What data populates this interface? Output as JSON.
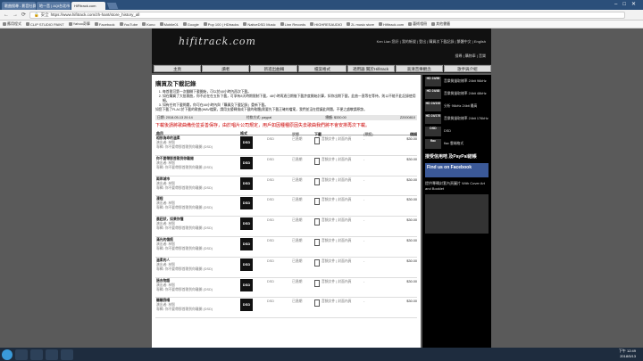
{
  "browser": {
    "tabs": [
      {
        "label": "歌曲搜尋 - 影音社群"
      },
      {
        "label": "地一音 | AQI台北市"
      },
      {
        "label": "HiFitrack.com"
      }
    ],
    "url": "https://www.hifitrack.com/zh-hant/store_history_all",
    "secure_label": "安全"
  },
  "bookmarks": [
    "應用程式",
    "CLIP STUDIO PAINT",
    "Yahoo奇摩",
    "Facebook",
    "YouTube",
    "Kono",
    "Mobile01",
    "Google",
    "Pop 100 | HDtracks",
    "NativeDSD Music",
    "Linn Records",
    "HIGHRESAUDIO",
    "2L music store",
    "Hifitrack.com",
    "藝術相冊",
    "其他書籤"
  ],
  "site": {
    "logo": "hifitrack.com",
    "user_line": "Ken Lian 您好 | 我的帳號 | 登出 | 購買次下載記錄 | 繁體中文 | English",
    "user_line2": "搜尋 | 購物車 | 音樂",
    "menu": [
      "主頁",
      "讀者",
      "新進出曲輯",
      "檔案格式",
      "適用器 關於Hifitrack",
      "高清音樂觀念",
      "歌手與介紹"
    ]
  },
  "content": {
    "title": "購買及下載記錄",
    "notes": [
      "每首歌可第一次翻開下載開始，可以於48小時內再次下載。",
      "如在購買了大批歌曲，你不必在在五折下載，可享有8天時期限制下載，48小時再過日期後下載許度開始計算，如你出期下載，此曲一直等在等待，則以不能不此記錄使用細。",
      "如有任何下載問題，你可在48小時內與「購買及下載記錄」重新下載。"
    ],
    "note_extra": "如您下載了FLAC於下載的歌曲(WAV檔案，請用支援轉換成下載的軟體)需要先下載正確的檔案，我們並沒在提議此問題，不便之處敬請原諒。",
    "order_date": "日期: 2018-05-13 20:14",
    "pay_method": "付款方式: paypal",
    "total": "總額: $330.00",
    "order_id": "Z2000810",
    "red_notice": "下載後請將歌曲備份並妥善保存，由於唱片公司規定，用戶如因種種原因失去歌曲我們將不會安排再次下載。",
    "headers": [
      "曲目",
      "格式",
      "",
      "狀態",
      "下載",
      "(預設)",
      "價錢"
    ],
    "rows": [
      {
        "title": "相依為命的溫柔",
        "artist": "演出者: 林智",
        "album": "專輯: 你不要帶那首歌到你離開 (DSD)",
        "format": "DSD",
        "type": "DSD",
        "status": "已過期",
        "dl": "音頻文件 | 封面內頁",
        "dash": "-",
        "price": "$30.00"
      },
      {
        "title": "你不要帶那首歌到你離開",
        "artist": "演出者: 林智",
        "album": "專輯: 你不要帶那首歌到你離開 (DSD)",
        "format": "DSD",
        "type": "DSD",
        "status": "已過期",
        "dl": "音頻文件 | 封面內頁",
        "dash": "-",
        "price": "$30.00"
      },
      {
        "title": "兩岸城市",
        "artist": "演出者: 林智",
        "album": "專輯: 你不要帶那首歌到你離開 (DSD)",
        "format": "DSD",
        "type": "DSD",
        "status": "已過期",
        "dl": "音頻文件 | 封面內頁",
        "dash": "-",
        "price": "$30.00"
      },
      {
        "title": "漫程",
        "artist": "演出者: 林智",
        "album": "專輯: 你不要帶那首歌到你離開 (DSD)",
        "format": "DSD",
        "type": "DSD",
        "status": "已過期",
        "dl": "音頻文件 | 封面內頁",
        "dash": "-",
        "price": "$30.00"
      },
      {
        "title": "農莊狀，如果你懂",
        "artist": "演出者: 林智",
        "album": "專輯: 你不要帶那首歌到你離開 (DSD)",
        "format": "DSD",
        "type": "DSD",
        "status": "已過期",
        "dl": "音頻文件 | 封面內頁",
        "dash": "-",
        "price": "$30.00"
      },
      {
        "title": "滿光的傷痕",
        "artist": "演出者: 林智",
        "album": "專輯: 你不要帶那首歌到你離開 (DSD)",
        "format": "DSD",
        "type": "DSD",
        "status": "已過期",
        "dl": "音頻文件 | 封面內頁",
        "dash": "-",
        "price": "$30.00"
      },
      {
        "title": "溫柔的人",
        "artist": "演出者: 林智",
        "album": "專輯: 你不要帶那首歌到你離開 (DSD)",
        "format": "DSD",
        "type": "DSD",
        "status": "已過期",
        "dl": "音頻文件 | 封面內頁",
        "dash": "-",
        "price": "$30.00"
      },
      {
        "title": "過去物語",
        "artist": "演出者: 林智",
        "album": "專輯: 你不要帶那首歌到你離開 (DSD)",
        "format": "DSD",
        "type": "DSD",
        "status": "已過期",
        "dl": "音頻文件 | 封面內頁",
        "dash": "-",
        "price": "$30.00"
      },
      {
        "title": "聽聽我唱",
        "artist": "演出者: 林智",
        "album": "專輯: 你不要帶那首歌到你離開 (DSD)",
        "format": "DSD",
        "type": "DSD",
        "status": "已過期",
        "dl": "音頻文件 | 封面內頁",
        "dash": "-",
        "price": "$30.00"
      }
    ]
  },
  "right": {
    "badges": [
      {
        "b": "HD 24/96",
        "t": "音樂質量取樣率 24bit 96kHz"
      },
      {
        "b": "HD 24/48",
        "t": "音樂質量取樣率 24bit 48kHz"
      },
      {
        "b": "HD 24/192",
        "t": "分析 96kHz 24bit 最高"
      },
      {
        "b": "HD 24/176",
        "t": "音樂質量取樣率 24bit 176kHz"
      },
      {
        "b": "DSD",
        "t": "DSD"
      },
      {
        "b": "flac",
        "t": "flac 雲端格式"
      }
    ],
    "paypal": "接受信用咭 及PayPal結帳",
    "fb": "Find us on Facebook",
    "promo": "提供專輯封套內頁圖片 With Cover Art and Booklet"
  },
  "taskbar": {
    "time": "下午 12:49",
    "date": "2018/5/13"
  }
}
